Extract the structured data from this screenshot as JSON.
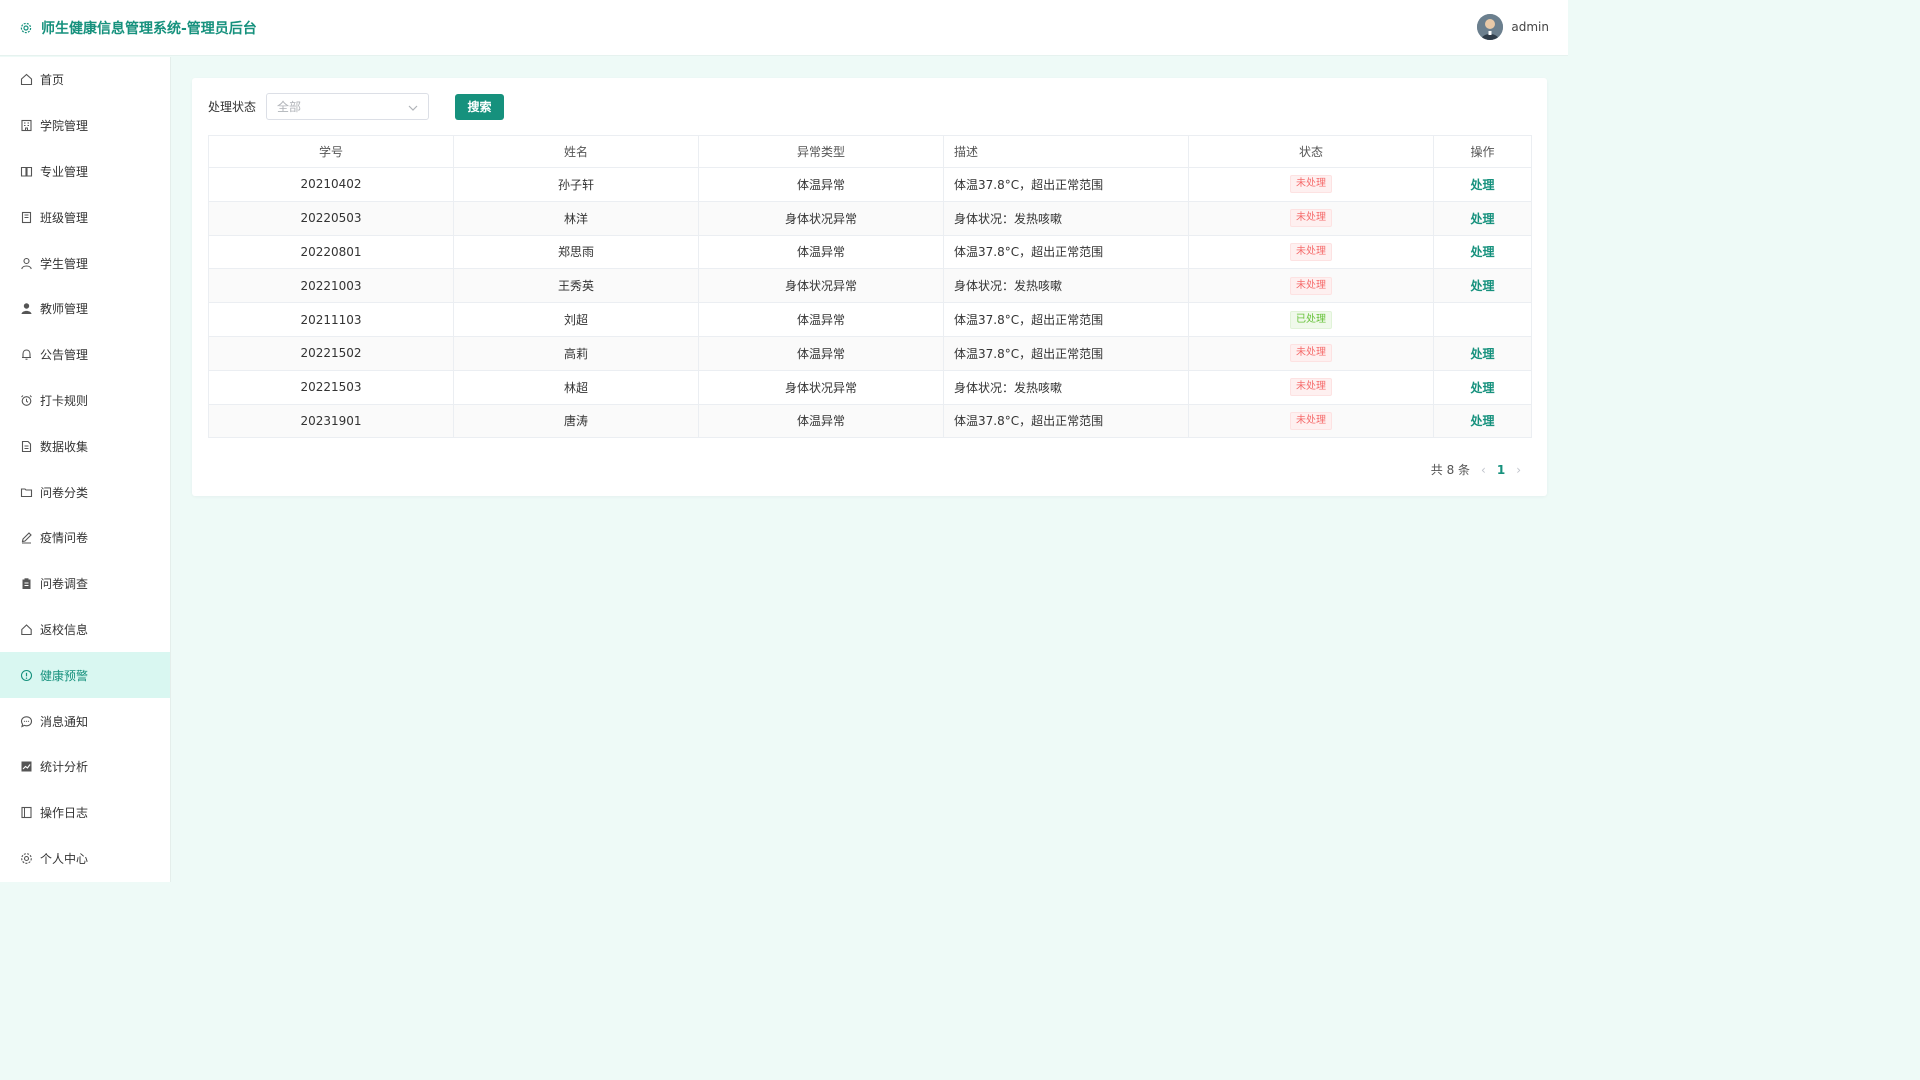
{
  "header": {
    "title": "师生健康信息管理系统-管理员后台",
    "username": "admin"
  },
  "sidebar": {
    "items": [
      {
        "label": "首页",
        "icon": "home-icon"
      },
      {
        "label": "学院管理",
        "icon": "building-icon"
      },
      {
        "label": "专业管理",
        "icon": "book-icon"
      },
      {
        "label": "班级管理",
        "icon": "notebook-icon"
      },
      {
        "label": "学生管理",
        "icon": "user-icon"
      },
      {
        "label": "教师管理",
        "icon": "user-filled-icon"
      },
      {
        "label": "公告管理",
        "icon": "bell-icon"
      },
      {
        "label": "打卡规则",
        "icon": "alarm-clock-icon"
      },
      {
        "label": "数据收集",
        "icon": "document-icon"
      },
      {
        "label": "问卷分类",
        "icon": "folder-icon"
      },
      {
        "label": "疫情问卷",
        "icon": "edit-pen-icon"
      },
      {
        "label": "问卷调查",
        "icon": "clipboard-icon"
      },
      {
        "label": "返校信息",
        "icon": "house-icon"
      },
      {
        "label": "健康预警",
        "icon": "warning-circle-icon",
        "active": true
      },
      {
        "label": "消息通知",
        "icon": "chat-dot-icon"
      },
      {
        "label": "统计分析",
        "icon": "trend-chart-icon"
      },
      {
        "label": "操作日志",
        "icon": "log-book-icon"
      },
      {
        "label": "个人中心",
        "icon": "setting-icon"
      }
    ]
  },
  "filter": {
    "label": "处理状态",
    "select_placeholder": "全部",
    "search_label": "搜索"
  },
  "table": {
    "columns": [
      "学号",
      "姓名",
      "异常类型",
      "描述",
      "状态",
      "操作"
    ],
    "rows": [
      {
        "id": "20210402",
        "name": "孙子轩",
        "type": "体温异常",
        "desc": "体温37.8°C，超出正常范围",
        "status": "未处理",
        "action": "处理"
      },
      {
        "id": "20220503",
        "name": "林洋",
        "type": "身体状况异常",
        "desc": "身体状况：发热咳嗽",
        "status": "未处理",
        "action": "处理"
      },
      {
        "id": "20220801",
        "name": "郑思雨",
        "type": "体温异常",
        "desc": "体温37.8°C，超出正常范围",
        "status": "未处理",
        "action": "处理"
      },
      {
        "id": "20221003",
        "name": "王秀英",
        "type": "身体状况异常",
        "desc": "身体状况：发热咳嗽",
        "status": "未处理",
        "action": "处理"
      },
      {
        "id": "20211103",
        "name": "刘超",
        "type": "体温异常",
        "desc": "体温37.8°C，超出正常范围",
        "status": "已处理",
        "action": ""
      },
      {
        "id": "20221502",
        "name": "高莉",
        "type": "体温异常",
        "desc": "体温37.8°C，超出正常范围",
        "status": "未处理",
        "action": "处理"
      },
      {
        "id": "20221503",
        "name": "林超",
        "type": "身体状况异常",
        "desc": "身体状况：发热咳嗽",
        "status": "未处理",
        "action": "处理"
      },
      {
        "id": "20231901",
        "name": "唐涛",
        "type": "体温异常",
        "desc": "体温37.8°C，超出正常范围",
        "status": "未处理",
        "action": "处理"
      }
    ]
  },
  "pagination": {
    "total_text": "共 8 条",
    "current_page": "1"
  },
  "colors": {
    "primary": "#16917d",
    "pending": "#f56c6c",
    "done": "#67c23a"
  }
}
